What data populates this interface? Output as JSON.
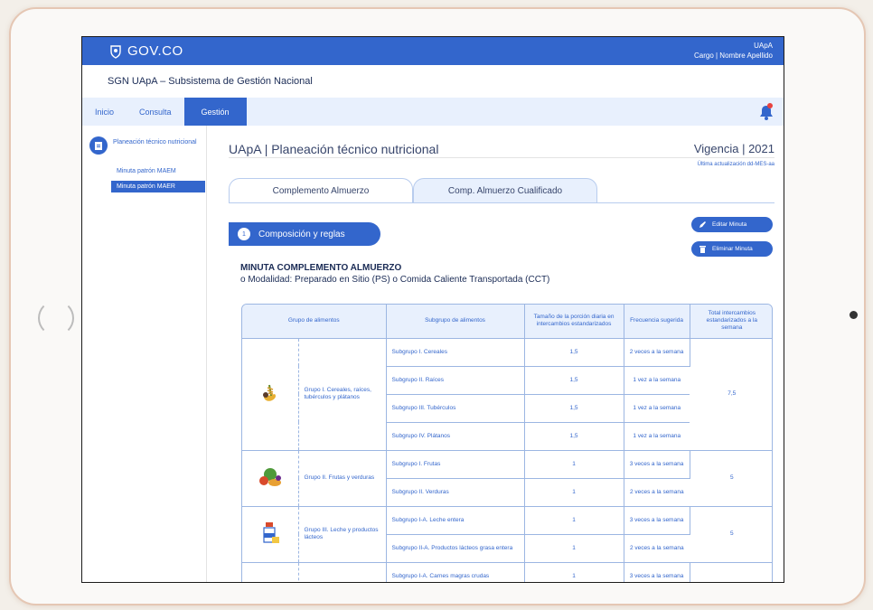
{
  "gov_bar": {
    "logo_text": "GOV.CO",
    "user_org": "UApA",
    "user_role": "Cargo | Nombre Apellido"
  },
  "system_title": "SGN UApA – Subsistema de Gestión Nacional",
  "nav": {
    "items": [
      {
        "label": "Inicio"
      },
      {
        "label": "Consulta"
      },
      {
        "label": "Gestión"
      }
    ]
  },
  "sidebar": {
    "header_label": "Planeación técnico nutricional",
    "links": [
      {
        "label": "Minuta patrón MAEM"
      },
      {
        "label": "Minuta patrón MAER"
      }
    ]
  },
  "page": {
    "title": "UApA | Planeación técnico nutricional",
    "vigencia": "Vigencia | 2021",
    "updated": "Última actualización dd-MES-aa"
  },
  "tabs": [
    {
      "label": "Complemento Almuerzo"
    },
    {
      "label": "Comp. Almuerzo Cualificado"
    }
  ],
  "section": {
    "number": "1",
    "label": "Composición y reglas"
  },
  "actions": {
    "edit_label": "Editar Minuta",
    "delete_label": "Eliminar Minuta"
  },
  "minuta": {
    "title": "MINUTA COMPLEMENTO ALMUERZO",
    "modalidad": "o Modalidad: Preparado en Sitio (PS) o Comida Caliente Transportada (CCT)"
  },
  "table": {
    "headers": [
      "Grupo de alimentos",
      "Subgrupo de alimentos",
      "Tamaño de la porción diaria en intercambios estandarizados",
      "Frecuencia sugerida",
      "Total intercambios estandarizados a la semana"
    ],
    "groups": [
      {
        "icon": "cereal-icon",
        "name": "Grupo I. Cereales, raíces, tubérculos y plátanos",
        "total": "7,5",
        "rows": [
          {
            "subgroup": "Subgrupo I. Cereales",
            "portion": "1,5",
            "freq": "2 veces a la semana"
          },
          {
            "subgroup": "Subgrupo II. Raíces",
            "portion": "1,5",
            "freq": "1 vez a la semana"
          },
          {
            "subgroup": "Subgrupo III. Tubérculos",
            "portion": "1,5",
            "freq": "1 vez a la semana"
          },
          {
            "subgroup": "Subgrupo IV. Plátanos",
            "portion": "1,5",
            "freq": "1 vez a la semana"
          }
        ]
      },
      {
        "icon": "fruits-vegetables-icon",
        "name": "Grupo II. Frutas y verduras",
        "total": "5",
        "rows": [
          {
            "subgroup": "Subgrupo I. Frutas",
            "portion": "1",
            "freq": "3 veces a la semana"
          },
          {
            "subgroup": "Subgrupo II. Verduras",
            "portion": "1",
            "freq": "2 veces a la semana"
          }
        ]
      },
      {
        "icon": "dairy-icon",
        "name": "Grupo III. Leche y productos lácteos",
        "total": "5",
        "rows": [
          {
            "subgroup": "Subgrupo I-A. Leche entera",
            "portion": "1",
            "freq": "3 veces a la semana"
          },
          {
            "subgroup": "Subgrupo II-A. Productos lácteos grasa entera",
            "portion": "1",
            "freq": "2 veces a la semana"
          }
        ]
      },
      {
        "icon": "meat-icon",
        "name": "",
        "total": "",
        "rows": [
          {
            "subgroup": "Subgrupo I-A. Carnes magras crudas",
            "portion": "1",
            "freq": "3 veces a la semana"
          }
        ]
      }
    ]
  },
  "colors": {
    "primary": "#3366cc",
    "light": "#e8f0fd",
    "text_dark": "#37456b",
    "alert": "#e8423f"
  }
}
